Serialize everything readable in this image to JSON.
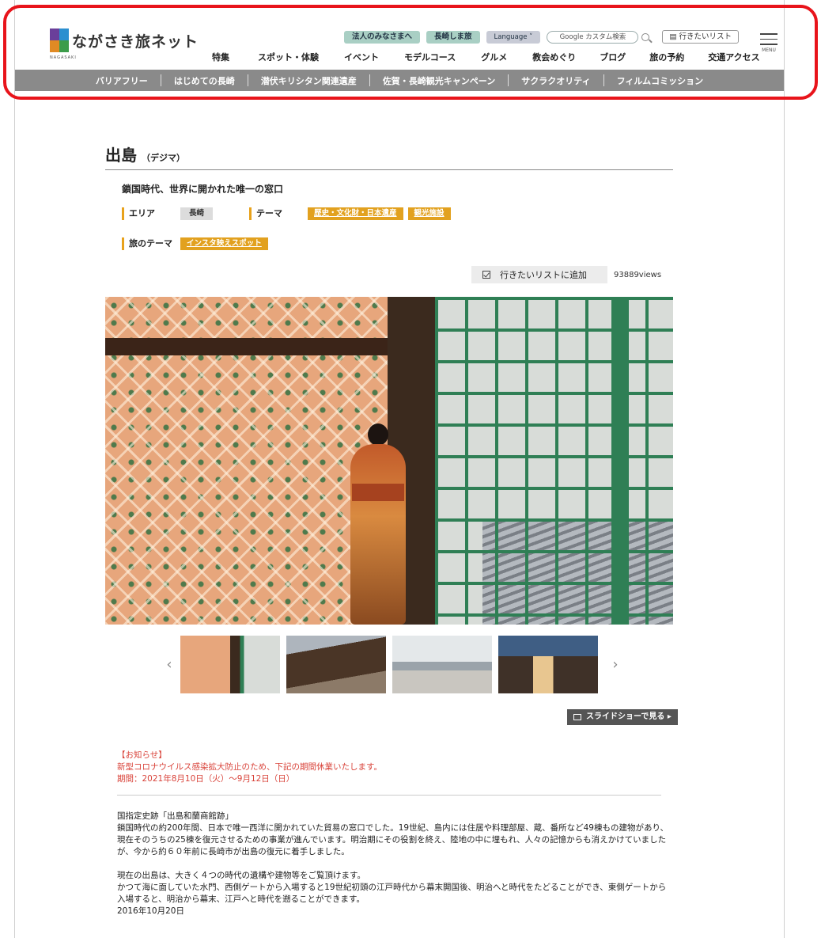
{
  "header": {
    "logo_text": "ながさき旅ネット",
    "logo_sub": "NAGASAKI",
    "util": {
      "corporate": "法人のみなさまへ",
      "island_trip": "長崎しま旅",
      "language": "Language ˅",
      "search_placeholder": "Google カスタム検索",
      "wishlist": "行きたいリスト"
    },
    "nav": [
      "特集",
      "スポット・体験",
      "イベント",
      "モデルコース",
      "グルメ",
      "教会めぐり",
      "ブログ",
      "旅の予約",
      "交通アクセス"
    ],
    "menu_label": "MENU"
  },
  "subnav": [
    "バリアフリー",
    "はじめての長崎",
    "潜伏キリシタン関連遺産",
    "佐賀・長崎観光キャンペーン",
    "サクラクオリティ",
    "フィルムコミッション"
  ],
  "spot": {
    "title": "出島",
    "reading": "（デジマ）",
    "lead": "鎖国時代、世界に開かれた唯一の窓口",
    "area_label": "エリア",
    "area_value": "長崎",
    "theme_label": "テーマ",
    "themes": [
      "歴史・文化財・日本遺産",
      "観光施設"
    ],
    "trip_theme_label": "旅のテーマ",
    "trip_theme": "インスタ映えスポット",
    "add_to_list": "行きたいリストに追加",
    "views": "93889views",
    "slideshow": "スライドショーで見る ▸"
  },
  "notice": {
    "heading": "【お知らせ】",
    "line1": "新型コロナウイルス感染拡大防止のため、下記の期間休業いたします。",
    "line2": "期間：2021年8月10日（火）〜9月12日（日）"
  },
  "body": {
    "p1_title": "国指定史跡「出島和蘭商館跡」",
    "p1_text": "鎖国時代の約200年間、日本で唯一西洋に開かれていた貿易の窓口でした。19世紀、島内には住居や料理部屋、蔵、番所など49棟もの建物があり、現在そのうちの25棟を復元させるための事業が進んでいます。明治期にその役割を終え、陸地の中に埋もれ、人々の記憶からも消えかけていましたが、今から約６０年前に長崎市が出島の復元に着手しました。",
    "p2_title": "現在の出島は、大きく４つの時代の遺構や建物等をご覧頂けます。",
    "p2_text": "かつて海に面していた水門、西側ゲートから入場すると19世紀初頭の江戸時代から幕末開国後、明治へと時代をたどることができ、東側ゲートから入場すると、明治から幕末、江戸へと時代を遡ることができます。",
    "date": "2016年10月20日"
  }
}
